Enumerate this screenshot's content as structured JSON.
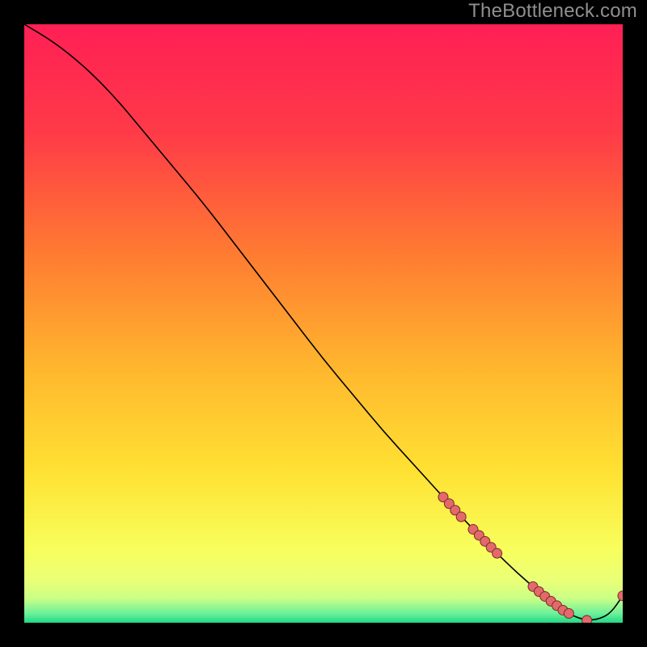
{
  "watermark": "TheBottleneck.com",
  "chart_data": {
    "type": "line",
    "title": "",
    "xlabel": "",
    "ylabel": "",
    "xlim": [
      0,
      100
    ],
    "ylim": [
      0,
      100
    ],
    "grid": false,
    "legend": false,
    "background_gradient": {
      "top": "#ff2050",
      "mid1": "#ff8a30",
      "mid2": "#ffe030",
      "bottom_band": "#f5ff70",
      "baseline": "#27e38a"
    },
    "series": [
      {
        "name": "bottleneck-curve",
        "color": "#000000",
        "x": [
          0,
          5,
          10,
          15,
          20,
          25,
          30,
          35,
          40,
          45,
          50,
          55,
          60,
          65,
          70,
          72,
          74,
          76,
          78,
          80,
          82,
          84,
          86,
          88,
          90,
          92,
          94,
          96,
          98,
          100
        ],
        "y": [
          100,
          97,
          93,
          88,
          82,
          76,
          70,
          63.5,
          57,
          50.5,
          44,
          38,
          32,
          26.5,
          21,
          18.8,
          16.7,
          14.6,
          12.6,
          10.6,
          8.7,
          6.9,
          5.2,
          3.6,
          2.1,
          1.0,
          0.4,
          0.6,
          1.6,
          4.5
        ]
      }
    ],
    "markers": [
      {
        "x": 70,
        "y": 21.0
      },
      {
        "x": 71,
        "y": 19.9
      },
      {
        "x": 72,
        "y": 18.8
      },
      {
        "x": 73,
        "y": 17.7
      },
      {
        "x": 75,
        "y": 15.6
      },
      {
        "x": 76,
        "y": 14.6
      },
      {
        "x": 77,
        "y": 13.6
      },
      {
        "x": 78,
        "y": 12.6
      },
      {
        "x": 79,
        "y": 11.6
      },
      {
        "x": 85,
        "y": 6.05
      },
      {
        "x": 86,
        "y": 5.2
      },
      {
        "x": 87,
        "y": 4.4
      },
      {
        "x": 88,
        "y": 3.6
      },
      {
        "x": 89,
        "y": 2.85
      },
      {
        "x": 90,
        "y": 2.1
      },
      {
        "x": 91,
        "y": 1.55
      },
      {
        "x": 94,
        "y": 0.4
      },
      {
        "x": 100,
        "y": 4.5
      }
    ],
    "marker_style": {
      "fill": "#e36a6a",
      "stroke": "#7a2a2a",
      "radius_px": 6
    }
  }
}
